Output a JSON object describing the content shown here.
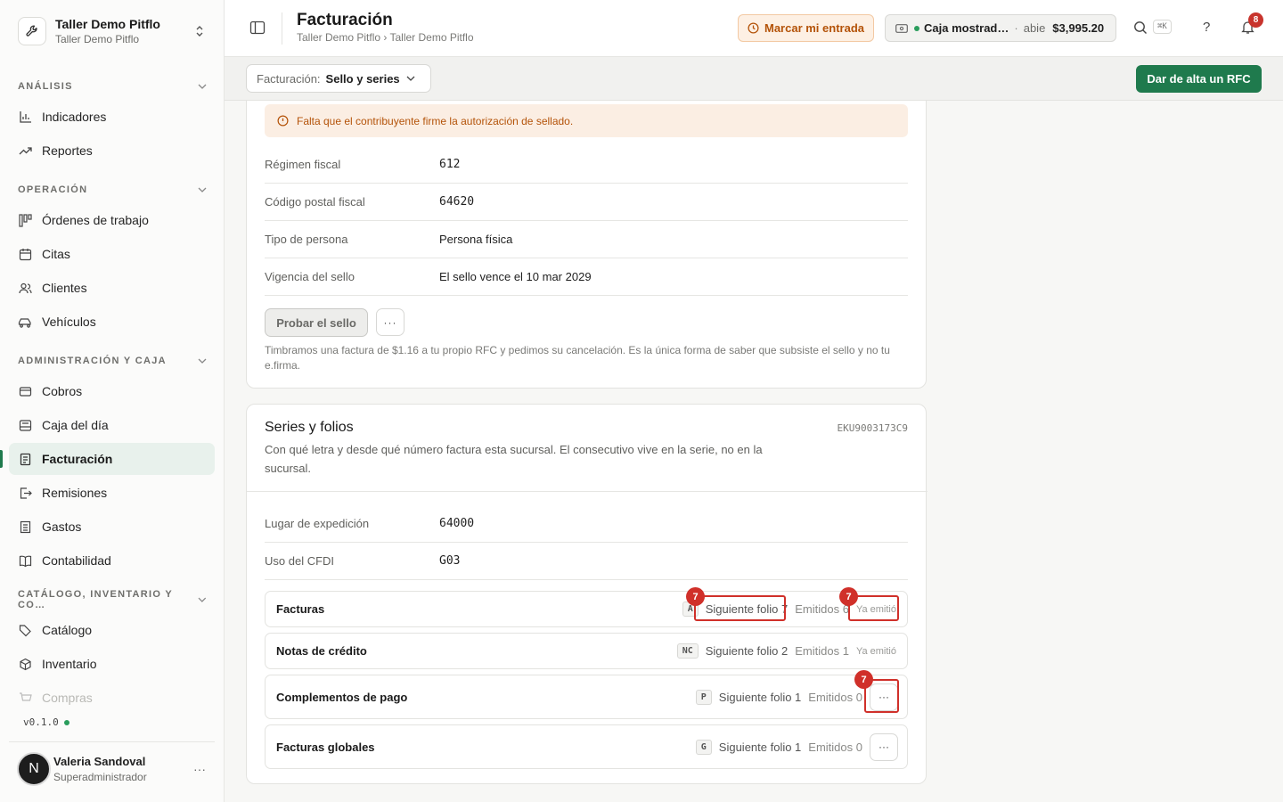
{
  "org": {
    "name": "Taller Demo Pitflo",
    "subtitle": "Taller Demo Pitflo"
  },
  "sidebar": {
    "sections": [
      {
        "title": "ANÁLISIS",
        "items": [
          {
            "label": "Indicadores",
            "icon": "bar-chart-icon"
          },
          {
            "label": "Reportes",
            "icon": "trend-icon"
          }
        ]
      },
      {
        "title": "OPERACIÓN",
        "items": [
          {
            "label": "Órdenes de trabajo",
            "icon": "kanban-icon"
          },
          {
            "label": "Citas",
            "icon": "calendar-icon"
          },
          {
            "label": "Clientes",
            "icon": "users-icon"
          },
          {
            "label": "Vehículos",
            "icon": "car-icon"
          }
        ]
      },
      {
        "title": "ADMINISTRACIÓN Y CAJA",
        "items": [
          {
            "label": "Cobros",
            "icon": "wallet-icon"
          },
          {
            "label": "Caja del día",
            "icon": "cash-register-icon"
          },
          {
            "label": "Facturación",
            "icon": "invoice-icon",
            "active": true
          },
          {
            "label": "Remisiones",
            "icon": "file-export-icon"
          },
          {
            "label": "Gastos",
            "icon": "receipt-icon"
          },
          {
            "label": "Contabilidad",
            "icon": "book-icon"
          }
        ]
      },
      {
        "title": "CATÁLOGO, INVENTARIO Y CO…",
        "items": [
          {
            "label": "Catálogo",
            "icon": "tag-icon"
          },
          {
            "label": "Inventario",
            "icon": "box-icon"
          },
          {
            "label": "Compras",
            "icon": "cart-icon"
          }
        ]
      }
    ],
    "version": "v0.1.0"
  },
  "user": {
    "name": "Valeria Sandoval",
    "role": "Superadministrador",
    "initial": "N"
  },
  "header": {
    "title": "Facturación",
    "breadcrumb": "Taller Demo Pitflo › Taller Demo Pitflo",
    "clock_in": "Marcar mi entrada",
    "cash": {
      "name": "Caja mostrad…",
      "separator": "·",
      "status": "abie",
      "amount": "$3,995.20"
    },
    "search_shortcut": "⌘K",
    "help": "?",
    "notifications": "8"
  },
  "toolbar": {
    "billing_label": "Facturación:",
    "billing_value": "Sello y series",
    "primary_button": "Dar de alta un RFC"
  },
  "seal_card": {
    "warning": "Falta que el contribuyente firme la autorización de sellado.",
    "rows": [
      {
        "key": "Régimen fiscal",
        "value": "612"
      },
      {
        "key": "Código postal fiscal",
        "value": "64620"
      },
      {
        "key": "Tipo de persona",
        "value": "Persona física"
      },
      {
        "key": "Vigencia del sello",
        "value": "El sello vence el 10 mar 2029"
      }
    ],
    "test_button": "Probar el sello",
    "more": "···",
    "note": "Timbramos una factura de $1.16 a tu propio RFC y pedimos su cancelación. Es la única forma de saber que subsiste el sello y no tu e.firma."
  },
  "series_card": {
    "title": "Series y folios",
    "rfc": "EKU9003173C9",
    "description": "Con qué letra y desde qué número factura esta sucursal. El consecutivo vive en la serie, no en la sucursal.",
    "rows": [
      {
        "key": "Lugar de expedición",
        "value": "64000"
      },
      {
        "key": "Uso del CFDI",
        "value": "G03"
      }
    ],
    "series": [
      {
        "name": "Facturas",
        "letter": "A",
        "next": "Siguiente folio 7",
        "emitted": "Emitidos 6",
        "ya": "Ya emitió"
      },
      {
        "name": "Notas de crédito",
        "letter": "NC",
        "next": "Siguiente folio 2",
        "emitted": "Emitidos 1",
        "ya": "Ya emitió"
      },
      {
        "name": "Complementos de pago",
        "letter": "P",
        "next": "Siguiente folio 1",
        "emitted": "Emitidos 0",
        "more": "···"
      },
      {
        "name": "Facturas globales",
        "letter": "G",
        "next": "Siguiente folio 1",
        "emitted": "Emitidos 0",
        "more": "···"
      }
    ]
  },
  "annotations": {
    "badge": "7"
  },
  "colors": {
    "accent": "#1f7a4d",
    "warning": "#b45309",
    "highlight": "#d0302a"
  }
}
